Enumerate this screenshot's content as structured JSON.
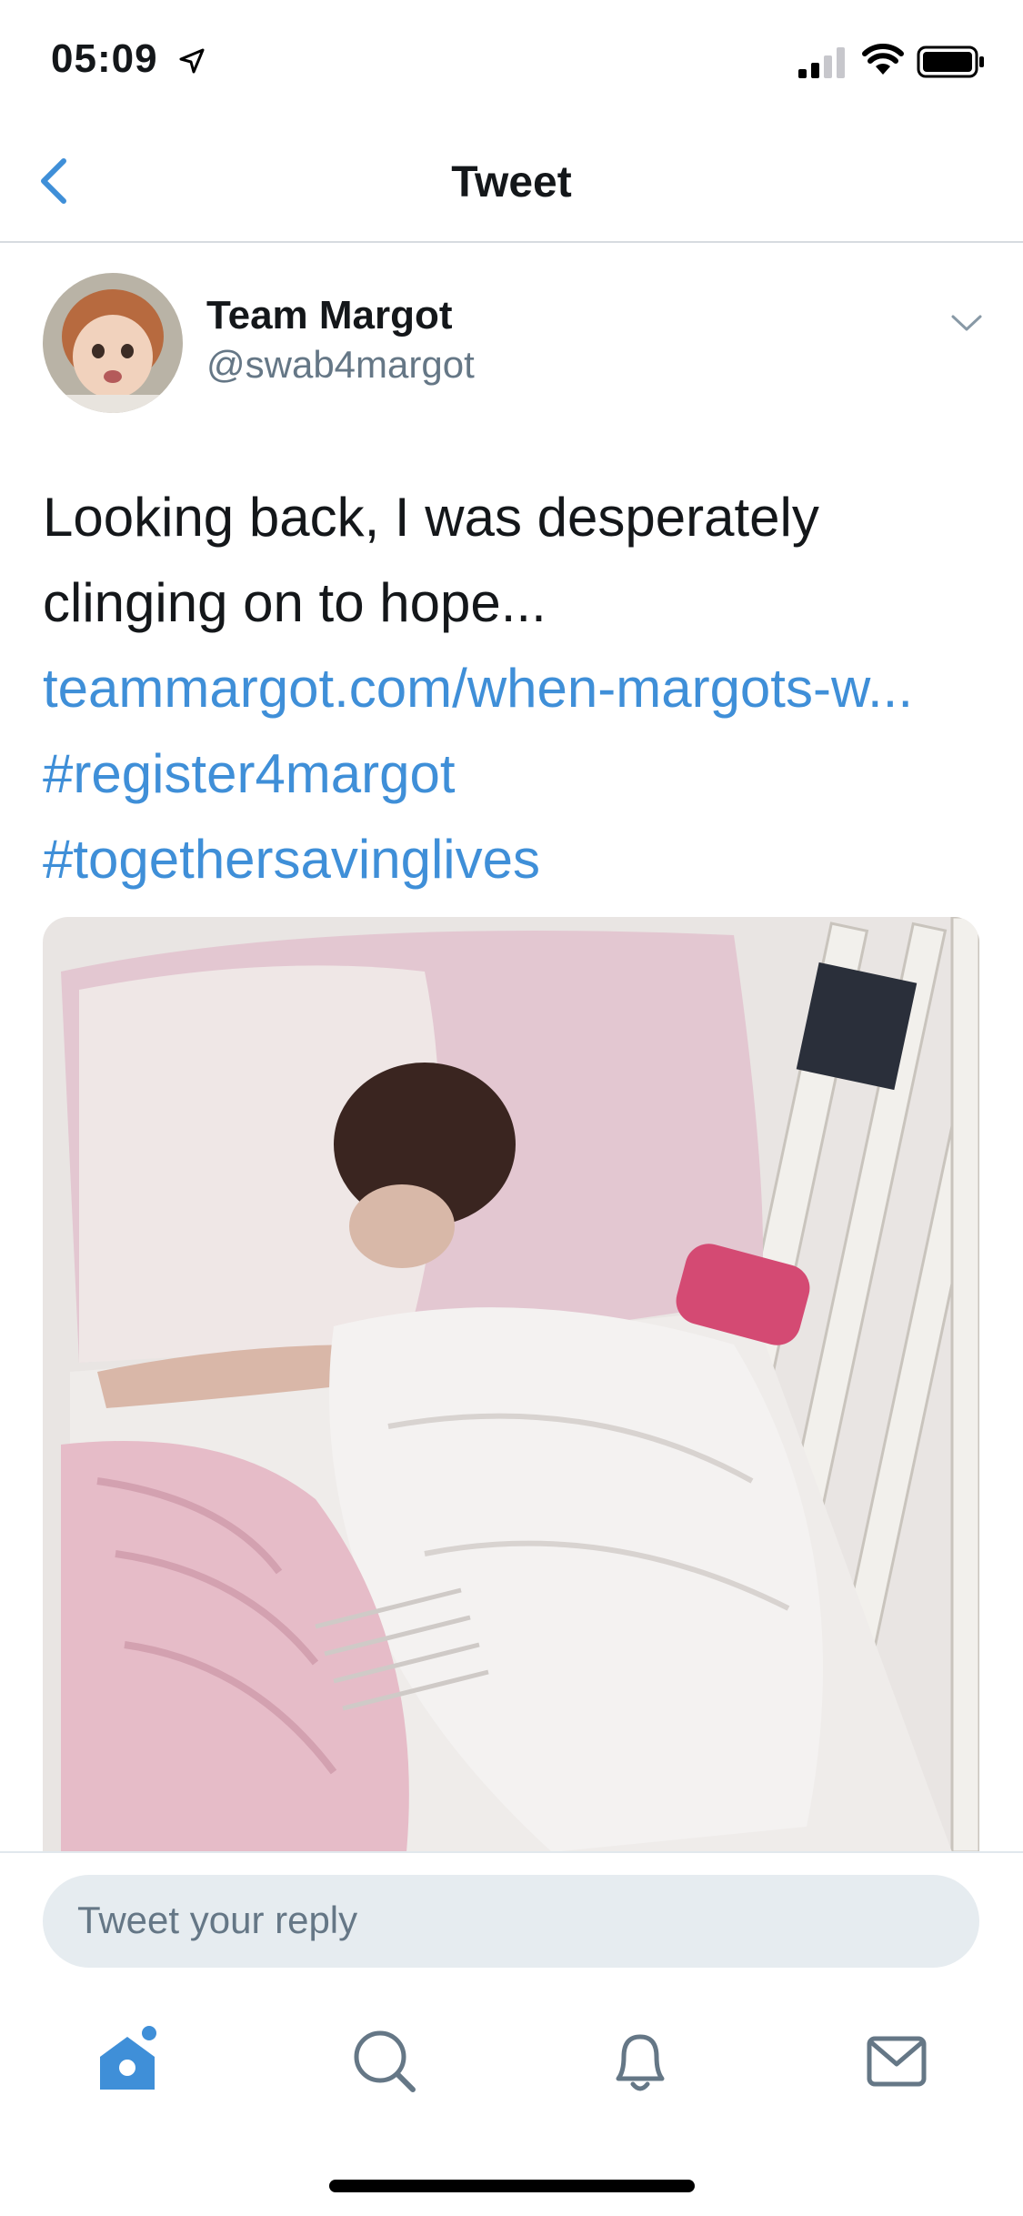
{
  "status_bar": {
    "time": "05:09"
  },
  "nav": {
    "title": "Tweet"
  },
  "tweet": {
    "author_name": "Team Margot",
    "author_handle": "@swab4margot",
    "text_lines": [
      "Looking back, I was desperately",
      "clinging on to hope..."
    ],
    "link": "teammargot.com/when-margots-w...",
    "hashtags": [
      "#register4margot",
      "#togethersavinglives"
    ]
  },
  "reply": {
    "placeholder": "Tweet your reply"
  },
  "tab_bar": {
    "items": [
      {
        "name": "home-icon",
        "active": true
      },
      {
        "name": "search-icon",
        "active": false
      },
      {
        "name": "notifications-icon",
        "active": false
      },
      {
        "name": "messages-icon",
        "active": false
      }
    ]
  },
  "colors": {
    "accent": "#3f8fd8",
    "secondary_text": "#657786",
    "reply_bg": "#e6ecf0"
  }
}
